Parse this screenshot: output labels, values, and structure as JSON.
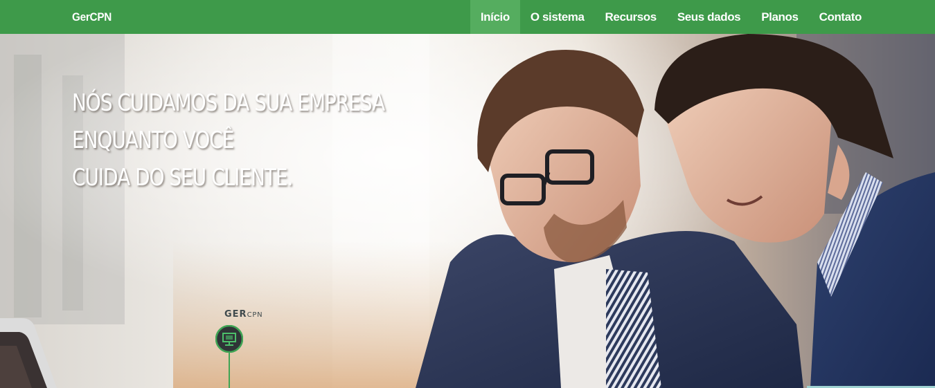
{
  "nav": {
    "brand": "GerCPN",
    "items": [
      {
        "label": "Início",
        "active": true
      },
      {
        "label": "O sistema",
        "active": false
      },
      {
        "label": "Recursos",
        "active": false
      },
      {
        "label": "Seus dados",
        "active": false
      },
      {
        "label": "Planos",
        "active": false
      },
      {
        "label": "Contato",
        "active": false
      }
    ]
  },
  "hero": {
    "title_lines": [
      "Nós cuidamos da sua empresa",
      "enquanto você",
      "cuida do seu cliente."
    ]
  },
  "logo": {
    "word_main": "GER",
    "word_small": "CPN",
    "icon": "monitor-icon"
  },
  "colors": {
    "navbar": "#3e9a4a",
    "navbar_active": "#55ad5f",
    "text_light": "#ffffff",
    "logo_green": "#3fa454"
  }
}
